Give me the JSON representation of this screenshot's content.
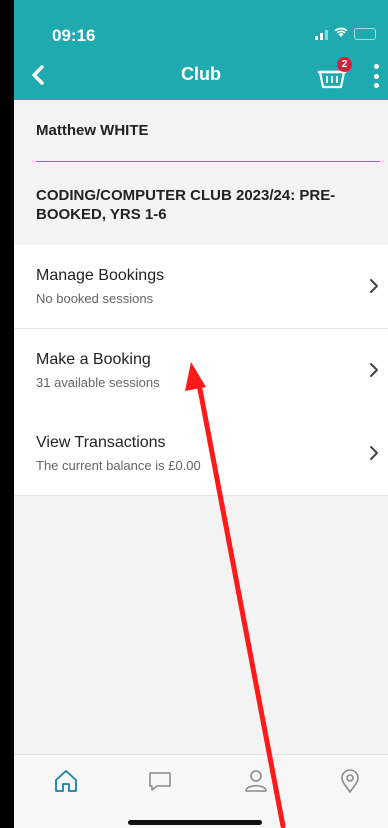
{
  "status_bar": {
    "time": "09:16"
  },
  "nav": {
    "title": "Club",
    "cart_badge": "2"
  },
  "header": {
    "student_name": "Matthew WHITE",
    "club_title": "CODING/COMPUTER CLUB 2023/24: PRE-BOOKED, YRS 1-6"
  },
  "menu": [
    {
      "label": "Manage Bookings",
      "sub": "No booked sessions"
    },
    {
      "label": "Make a Booking",
      "sub": "31 available sessions"
    },
    {
      "label": "View Transactions",
      "sub": "The current balance is £0.00"
    }
  ],
  "tabs": [
    "home",
    "messages",
    "profile",
    "location"
  ],
  "colors": {
    "accent": "#1faab0",
    "badge": "#d6203a",
    "arrow": "#ff1a1a",
    "tab_active": "#1a7fa8",
    "tab_inactive": "#8a8a8a"
  }
}
